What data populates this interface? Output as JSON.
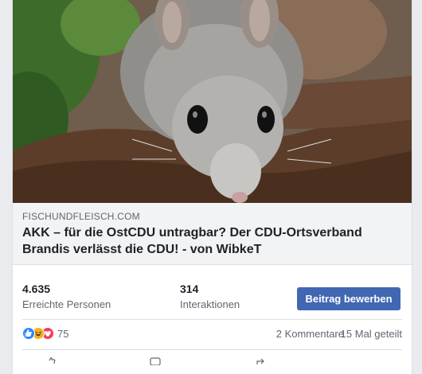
{
  "link_preview": {
    "domain": "FISCHUNDFLEISCH.COM",
    "headline": "AKK – für die OstCDU untragbar? Der CDU-Ortsverband Brandis verlässt die CDU! - von WibkeT"
  },
  "insights": {
    "reach_value": "4.635",
    "reach_label": "Erreichte Personen",
    "engagement_value": "314",
    "engagement_label": "Interaktionen",
    "promote_label": "Beitrag bewerben"
  },
  "reactions": {
    "icons": [
      "like-icon",
      "haha-icon",
      "love-icon"
    ],
    "count": "75",
    "comments": "2 Kommentare",
    "shares": "15 Mal geteilt"
  },
  "colors": {
    "accent": "#4267b2",
    "like": "#2d88ff",
    "haha": "#f7b125",
    "love": "#f33e58"
  }
}
